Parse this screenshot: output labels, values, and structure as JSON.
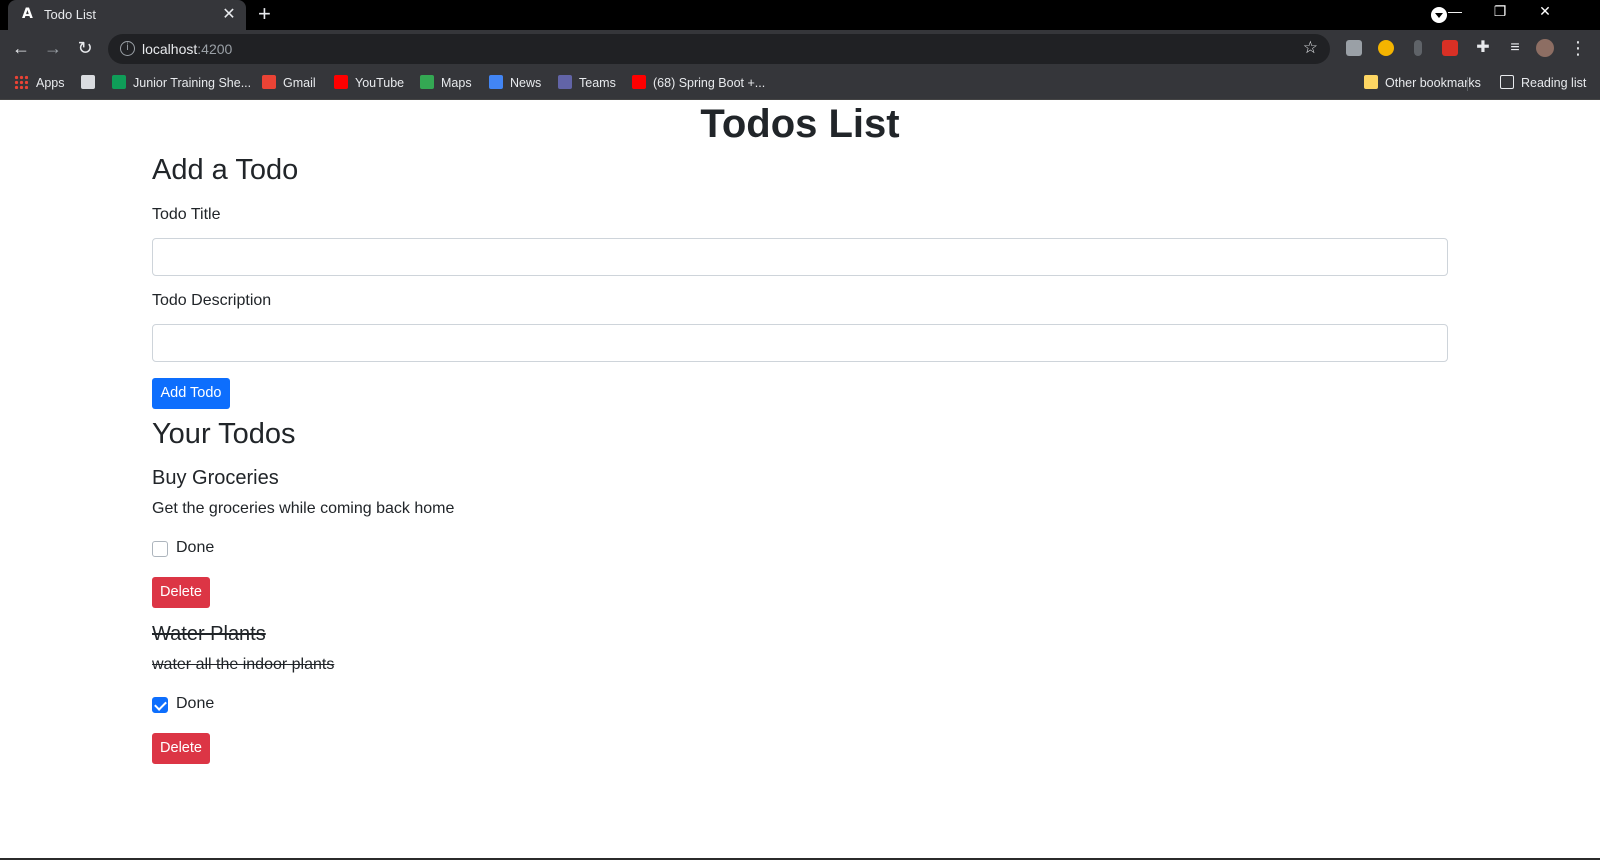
{
  "browser": {
    "tab_title": "Todo List",
    "tab_favicon": "A",
    "url_host": "localhost",
    "url_port": ":4200",
    "bookmarks": [
      {
        "label": "Apps",
        "icon": "apps-grid-icon"
      },
      {
        "label": "",
        "icon": "search-bookmark-icon"
      },
      {
        "label": "Junior Training She...",
        "icon": "sheets-icon"
      },
      {
        "label": "Gmail",
        "icon": "gmail-icon"
      },
      {
        "label": "YouTube",
        "icon": "youtube-icon"
      },
      {
        "label": "Maps",
        "icon": "maps-icon"
      },
      {
        "label": "News",
        "icon": "news-icon"
      },
      {
        "label": "Teams",
        "icon": "teams-icon"
      },
      {
        "label": "(68) Spring Boot +...",
        "icon": "youtube-icon"
      }
    ],
    "other_bookmarks": "Other bookmarks",
    "reading_list": "Reading list"
  },
  "page": {
    "title": "Todos List",
    "add_section": {
      "heading": "Add a Todo",
      "title_label": "Todo Title",
      "title_value": "",
      "description_label": "Todo Description",
      "description_value": "",
      "submit_label": "Add Todo"
    },
    "list_heading": "Your Todos",
    "todos": [
      {
        "title": "Buy Groceries",
        "description": "Get the groceries while coming back home",
        "done": false,
        "done_label": "Done",
        "delete_label": "Delete"
      },
      {
        "title": "Water Plants",
        "description": "water all the indoor plants",
        "done": true,
        "done_label": "Done",
        "delete_label": "Delete"
      }
    ]
  },
  "colors": {
    "primary": "#0d6efd",
    "danger": "#dc3545",
    "chrome_dark": "#35363a"
  }
}
